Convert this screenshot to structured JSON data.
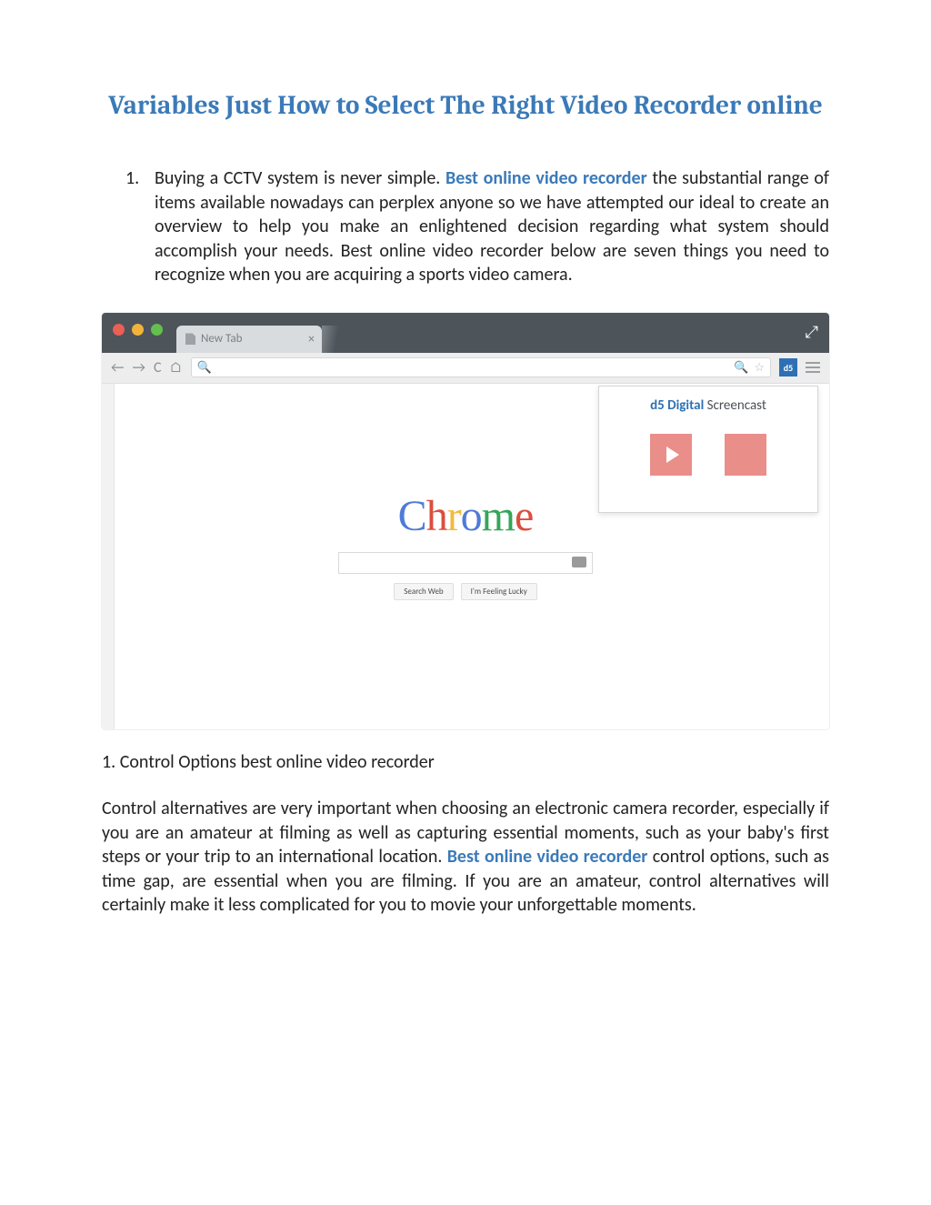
{
  "title": "Variables Just How to Select The Right Video Recorder online",
  "list_item": {
    "number": "1.",
    "pre": "Buying a CCTV system is never simple. ",
    "link": "Best online video recorder",
    "post": " the substantial range of items available nowadays can perplex anyone so we have attempted our ideal to create an overview to help you make an enlightened decision regarding what system should accomplish your needs. Best online video recorder below are  seven things you need to recognize when you are acquiring a sports video camera."
  },
  "browser": {
    "tab_label": "New Tab",
    "logo_letters": [
      "C",
      "h",
      "r",
      "o",
      "m",
      "e"
    ],
    "button_search": "Search Web",
    "button_lucky": "I'm Feeling Lucky",
    "popup_brand_prefix": "d5 ",
    "popup_brand_main": "Digital ",
    "popup_brand_suffix": "Screencast"
  },
  "section_heading": "1. Control Options best online video recorder",
  "paragraph": {
    "pre": "Control alternatives are very important when choosing an electronic camera recorder, especially if you are an amateur at filming as well as capturing essential moments, such as your baby's first steps or your trip to an international location. ",
    "link": "Best online video recorder",
    "post": " control options, such as time gap, are essential when you are filming. If you are an amateur, control alternatives will certainly make it less complicated for you to movie your unforgettable moments."
  }
}
